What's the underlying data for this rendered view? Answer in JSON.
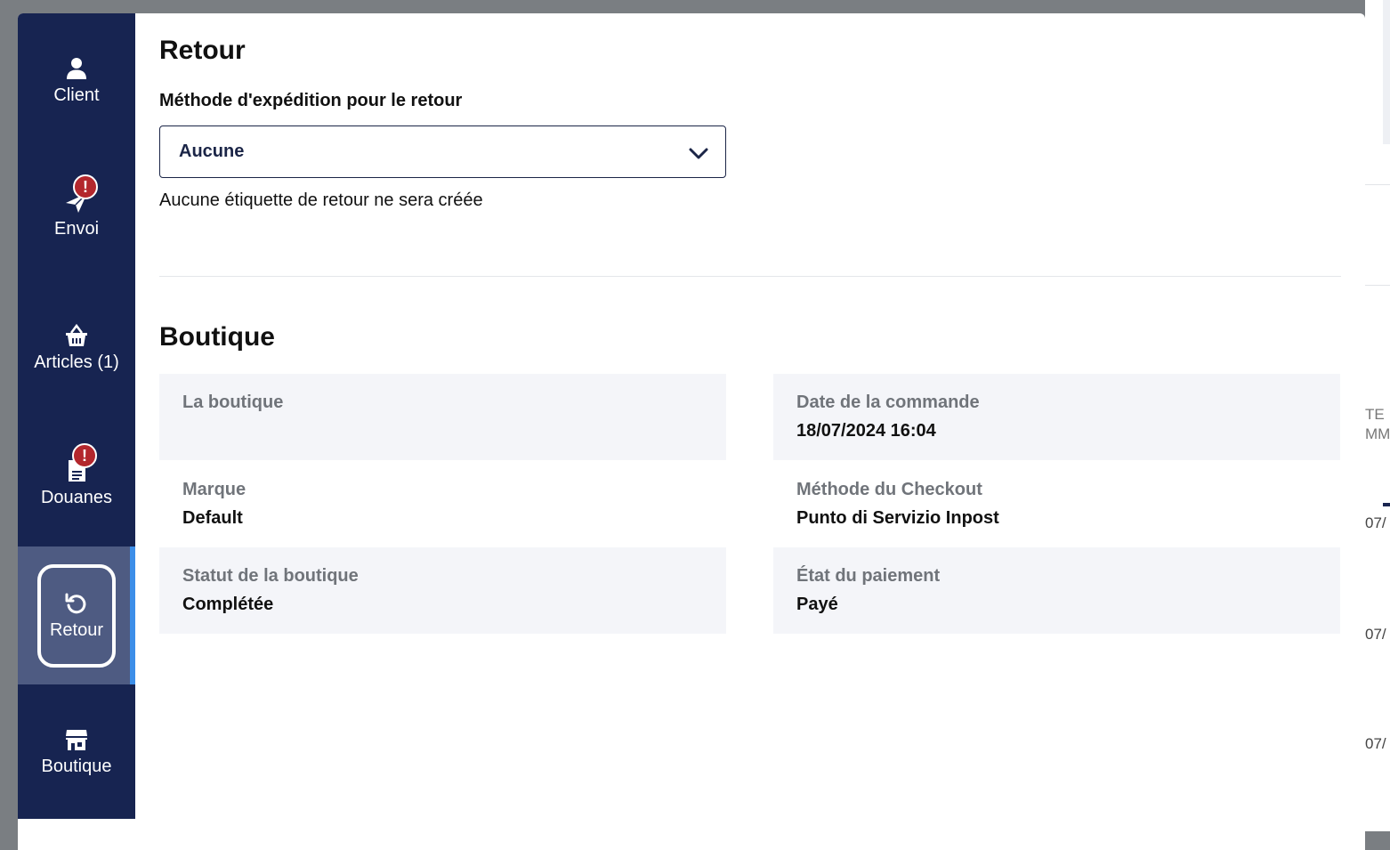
{
  "sidebar": {
    "items": [
      {
        "id": "client",
        "label": "Client",
        "icon": "person-icon",
        "alert": false
      },
      {
        "id": "envoi",
        "label": "Envoi",
        "icon": "paper-plane-icon",
        "alert": true
      },
      {
        "id": "articles",
        "label": "Articles (1)",
        "icon": "basket-icon",
        "alert": false
      },
      {
        "id": "douanes",
        "label": "Douanes",
        "icon": "document-icon",
        "alert": true
      },
      {
        "id": "retour",
        "label": "Retour",
        "icon": "undo-icon",
        "alert": false,
        "active": true
      },
      {
        "id": "boutique",
        "label": "Boutique",
        "icon": "store-icon",
        "alert": false
      }
    ],
    "badge_glyph": "!"
  },
  "retour": {
    "title": "Retour",
    "method_label": "Méthode d'expédition pour le retour",
    "method_value": "Aucune",
    "helper": "Aucune étiquette de retour ne sera créée"
  },
  "boutique": {
    "title": "Boutique",
    "fields": {
      "shop": {
        "label": "La boutique",
        "value": ""
      },
      "order_date": {
        "label": "Date de la commande",
        "value": "18/07/2024 16:04"
      },
      "brand": {
        "label": "Marque",
        "value": "Default"
      },
      "checkout_method": {
        "label": "Méthode du Checkout",
        "value": "Punto di Servizio Inpost"
      },
      "shop_status": {
        "label": "Statut de la boutique",
        "value": "Complétée"
      },
      "payment_status": {
        "label": "État du paiement",
        "value": "Payé"
      }
    }
  },
  "background": {
    "header_fragment": "TE\nMM",
    "cell_fragments": [
      "07/",
      "07/",
      "07/"
    ]
  },
  "colors": {
    "sidebar_bg": "#172451",
    "active_bg": "#4e5b82",
    "active_bar": "#3c8ee8",
    "alert": "#b3272d",
    "panel_bg": "#f4f5f9"
  }
}
